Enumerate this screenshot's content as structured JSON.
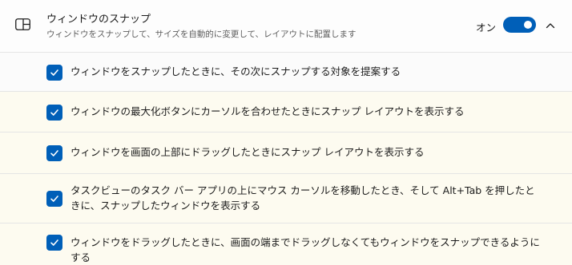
{
  "header": {
    "icon": "snap-window-icon",
    "title": "ウィンドウのスナップ",
    "description": "ウィンドウをスナップして、サイズを自動的に変更して、レイアウトに配置します",
    "toggle_label": "オン",
    "toggle_on": true,
    "chevron": "chevron-up-icon"
  },
  "options": [
    {
      "label": "ウィンドウをスナップしたときに、その次にスナップする対象を提案する",
      "checked": true
    },
    {
      "label": "ウィンドウの最大化ボタンにカーソルを合わせたときにスナップ レイアウトを表示する",
      "checked": true
    },
    {
      "label": "ウィンドウを画面の上部にドラッグしたときにスナップ レイアウトを表示する",
      "checked": true
    },
    {
      "label": "タスクビューのタスク バー アプリの上にマウス カーソルを移動したとき、そして Alt+Tab を押したときに、スナップしたウィンドウを表示する",
      "checked": true
    },
    {
      "label": "ウィンドウをドラッグしたときに、画面の端までドラッグしなくてもウィンドウをスナップできるようにする",
      "checked": true
    }
  ],
  "colors": {
    "accent": "#005fb8",
    "text": "#1b1b1b",
    "secondary_text": "#5d5d5d",
    "divider": "#e5e5e5"
  }
}
